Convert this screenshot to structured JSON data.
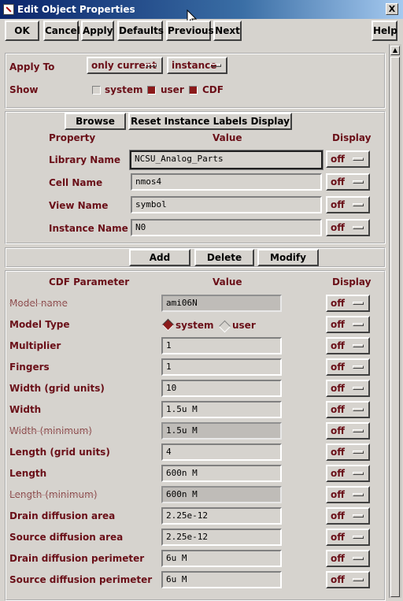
{
  "window": {
    "title": "Edit Object Properties",
    "close_glyph": "X"
  },
  "toolbar": {
    "ok": "OK",
    "cancel": "Cancel",
    "apply": "Apply",
    "defaults": "Defaults",
    "previous": "Previous",
    "next": "Next",
    "help": "Help"
  },
  "apply_to": {
    "label": "Apply To",
    "scope": "only current",
    "object": "instance"
  },
  "show": {
    "label": "Show",
    "system": "system",
    "system_checked": false,
    "user": "user",
    "user_checked": true,
    "cdf": "CDF",
    "cdf_checked": true
  },
  "instance_section": {
    "browse": "Browse",
    "reset": "Reset Instance Labels Display",
    "headers": {
      "property": "Property",
      "value": "Value",
      "display": "Display"
    },
    "rows": [
      {
        "label": "Library Name",
        "value": "NCSU_Analog_Parts",
        "display": "off"
      },
      {
        "label": "Cell Name",
        "value": "nmos4",
        "display": "off"
      },
      {
        "label": "View Name",
        "value": "symbol",
        "display": "off"
      },
      {
        "label": "Instance Name",
        "value": "N0",
        "display": "off"
      }
    ]
  },
  "prop_buttons": {
    "add": "Add",
    "delete": "Delete",
    "modify": "Modify"
  },
  "cdf": {
    "headers": {
      "param": "CDF Parameter",
      "value": "Value",
      "display": "Display"
    },
    "rows": [
      {
        "label": "Model name",
        "value": "ami06N",
        "display": "off"
      },
      {
        "label": "Model Type",
        "opt_system": "system",
        "opt_user": "user",
        "selected": "system",
        "display": "off"
      },
      {
        "label": "Multiplier",
        "value": "1",
        "display": "off"
      },
      {
        "label": "Fingers",
        "value": "1",
        "display": "off"
      },
      {
        "label": "Width (grid units)",
        "value": "10",
        "display": "off"
      },
      {
        "label": "Width",
        "value": "1.5u M",
        "display": "off"
      },
      {
        "label": "Width (minimum)",
        "value": "1.5u M",
        "display": "off"
      },
      {
        "label": "Length (grid units)",
        "value": "4",
        "display": "off"
      },
      {
        "label": "Length",
        "value": "600n M",
        "display": "off"
      },
      {
        "label": "Length (minimum)",
        "value": "600n M",
        "display": "off"
      },
      {
        "label": "Drain diffusion area",
        "value": "2.25e-12",
        "display": "off"
      },
      {
        "label": "Source diffusion area",
        "value": "2.25e-12",
        "display": "off"
      },
      {
        "label": "Drain diffusion perimeter",
        "value": "6u M",
        "display": "off"
      },
      {
        "label": "Source diffusion perimeter",
        "value": "6u M",
        "display": "off"
      }
    ]
  },
  "icons": {
    "app": "window-app-icon",
    "close": "close-icon",
    "cursor": "mouse-pointer-icon"
  },
  "colors": {
    "label": "#6a0f18",
    "checked": "#8b1a1a",
    "titlebar": "#0a246a",
    "background": "#d6d3ce"
  }
}
